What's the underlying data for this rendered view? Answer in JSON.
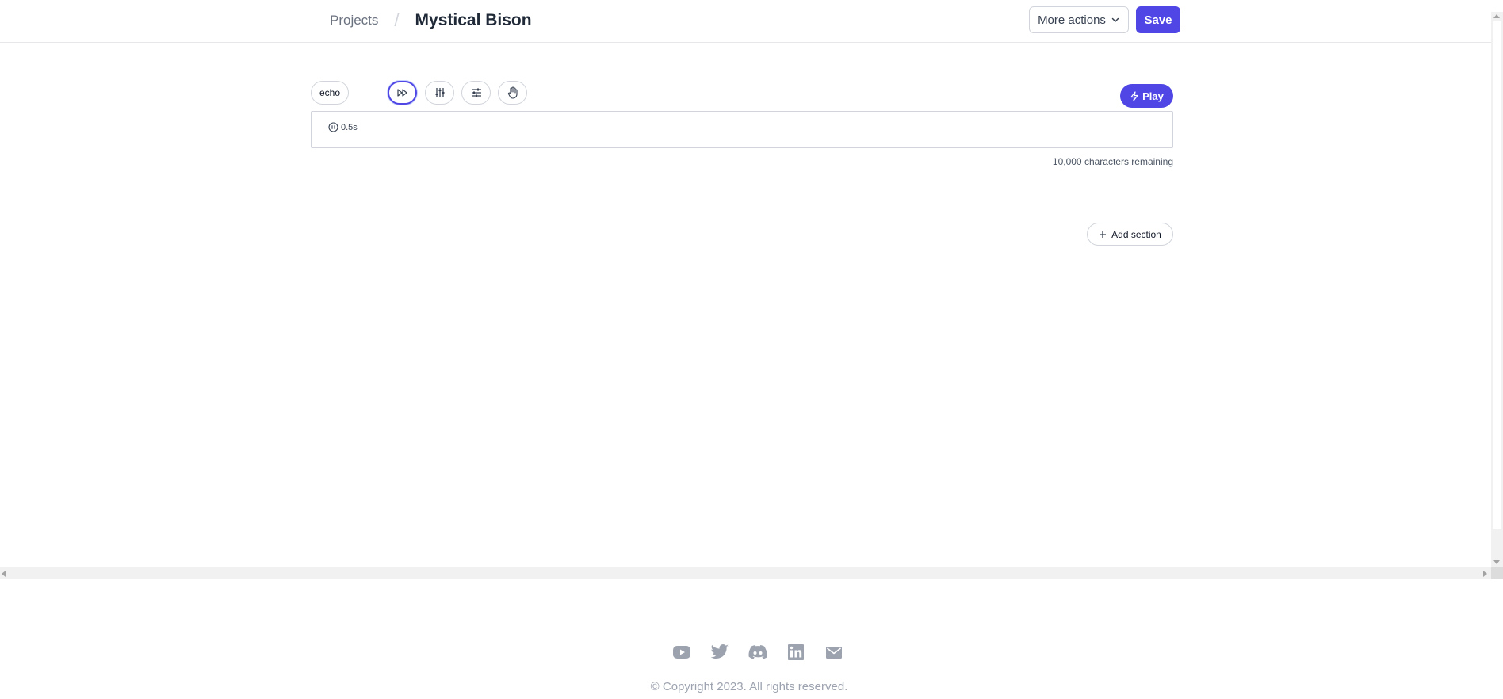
{
  "header": {
    "breadcrumb_root": "Projects",
    "breadcrumb_separator": "/",
    "title": "Mystical Bison",
    "more_actions_label": "More actions",
    "save_label": "Save"
  },
  "editor": {
    "voice_chip": "echo",
    "tools": [
      {
        "name": "fast-forward-icon",
        "active": true
      },
      {
        "name": "sliders-vertical-icon",
        "active": false
      },
      {
        "name": "sliders-horizontal-icon",
        "active": false
      },
      {
        "name": "hand-icon",
        "active": false
      }
    ],
    "play_label": "Play",
    "pause_duration": "0.5s",
    "chars_remaining": "10,000 characters remaining",
    "add_section_label": "Add section"
  },
  "footer": {
    "icons": [
      "youtube-icon",
      "twitter-icon",
      "discord-icon",
      "linkedin-icon",
      "mail-icon"
    ],
    "copyright": "© Copyright 2023. All rights reserved."
  },
  "colors": {
    "accent": "#4f46e5",
    "border": "#d1d5db",
    "muted_text": "#6b7280",
    "footer_icon": "#9ca3af"
  }
}
